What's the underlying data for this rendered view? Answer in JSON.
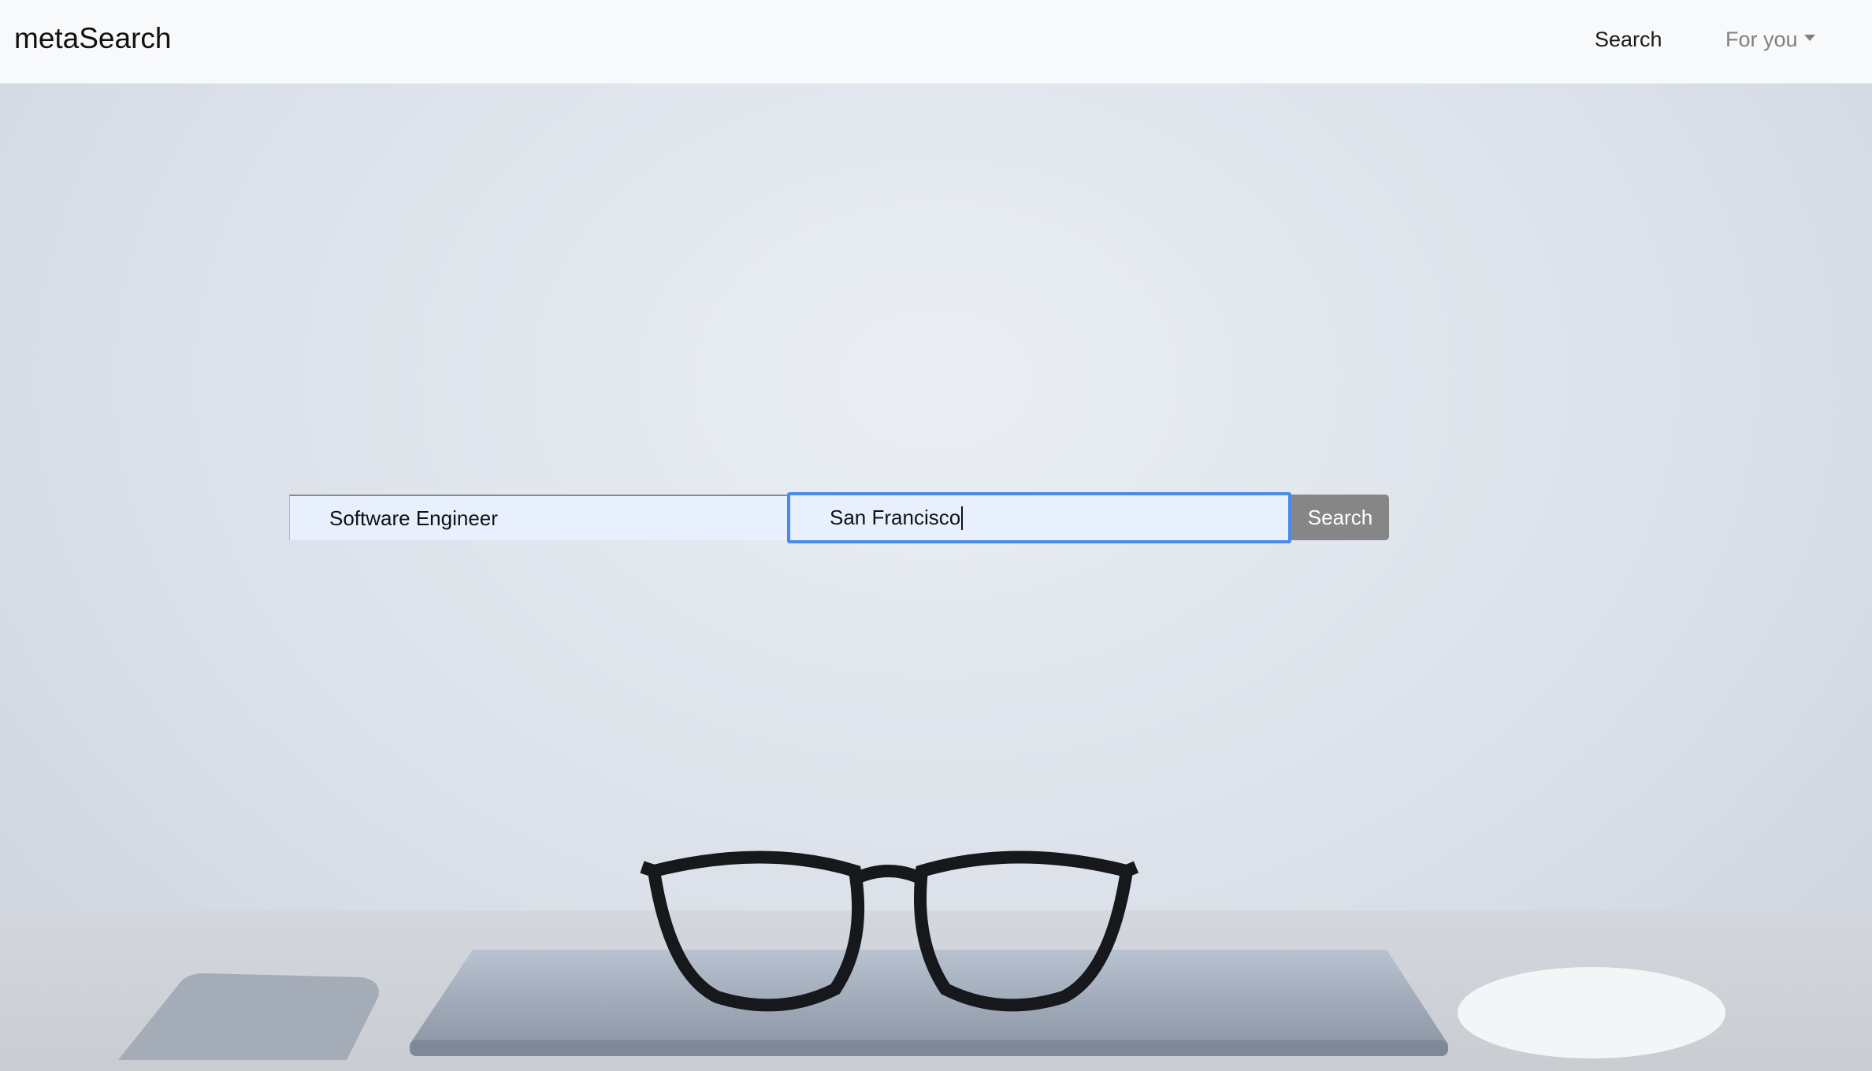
{
  "navbar": {
    "brand": "metaSearch",
    "search_link": "Search",
    "for_you_dropdown": "For you"
  },
  "search_form": {
    "job_input_value": "Software Engineer",
    "location_input_value": "San Francisco",
    "submit_label": "Search"
  },
  "colors": {
    "focus_border": "#4a8ae8",
    "button_bg": "#868686",
    "input_bg": "#e8f0fe"
  }
}
